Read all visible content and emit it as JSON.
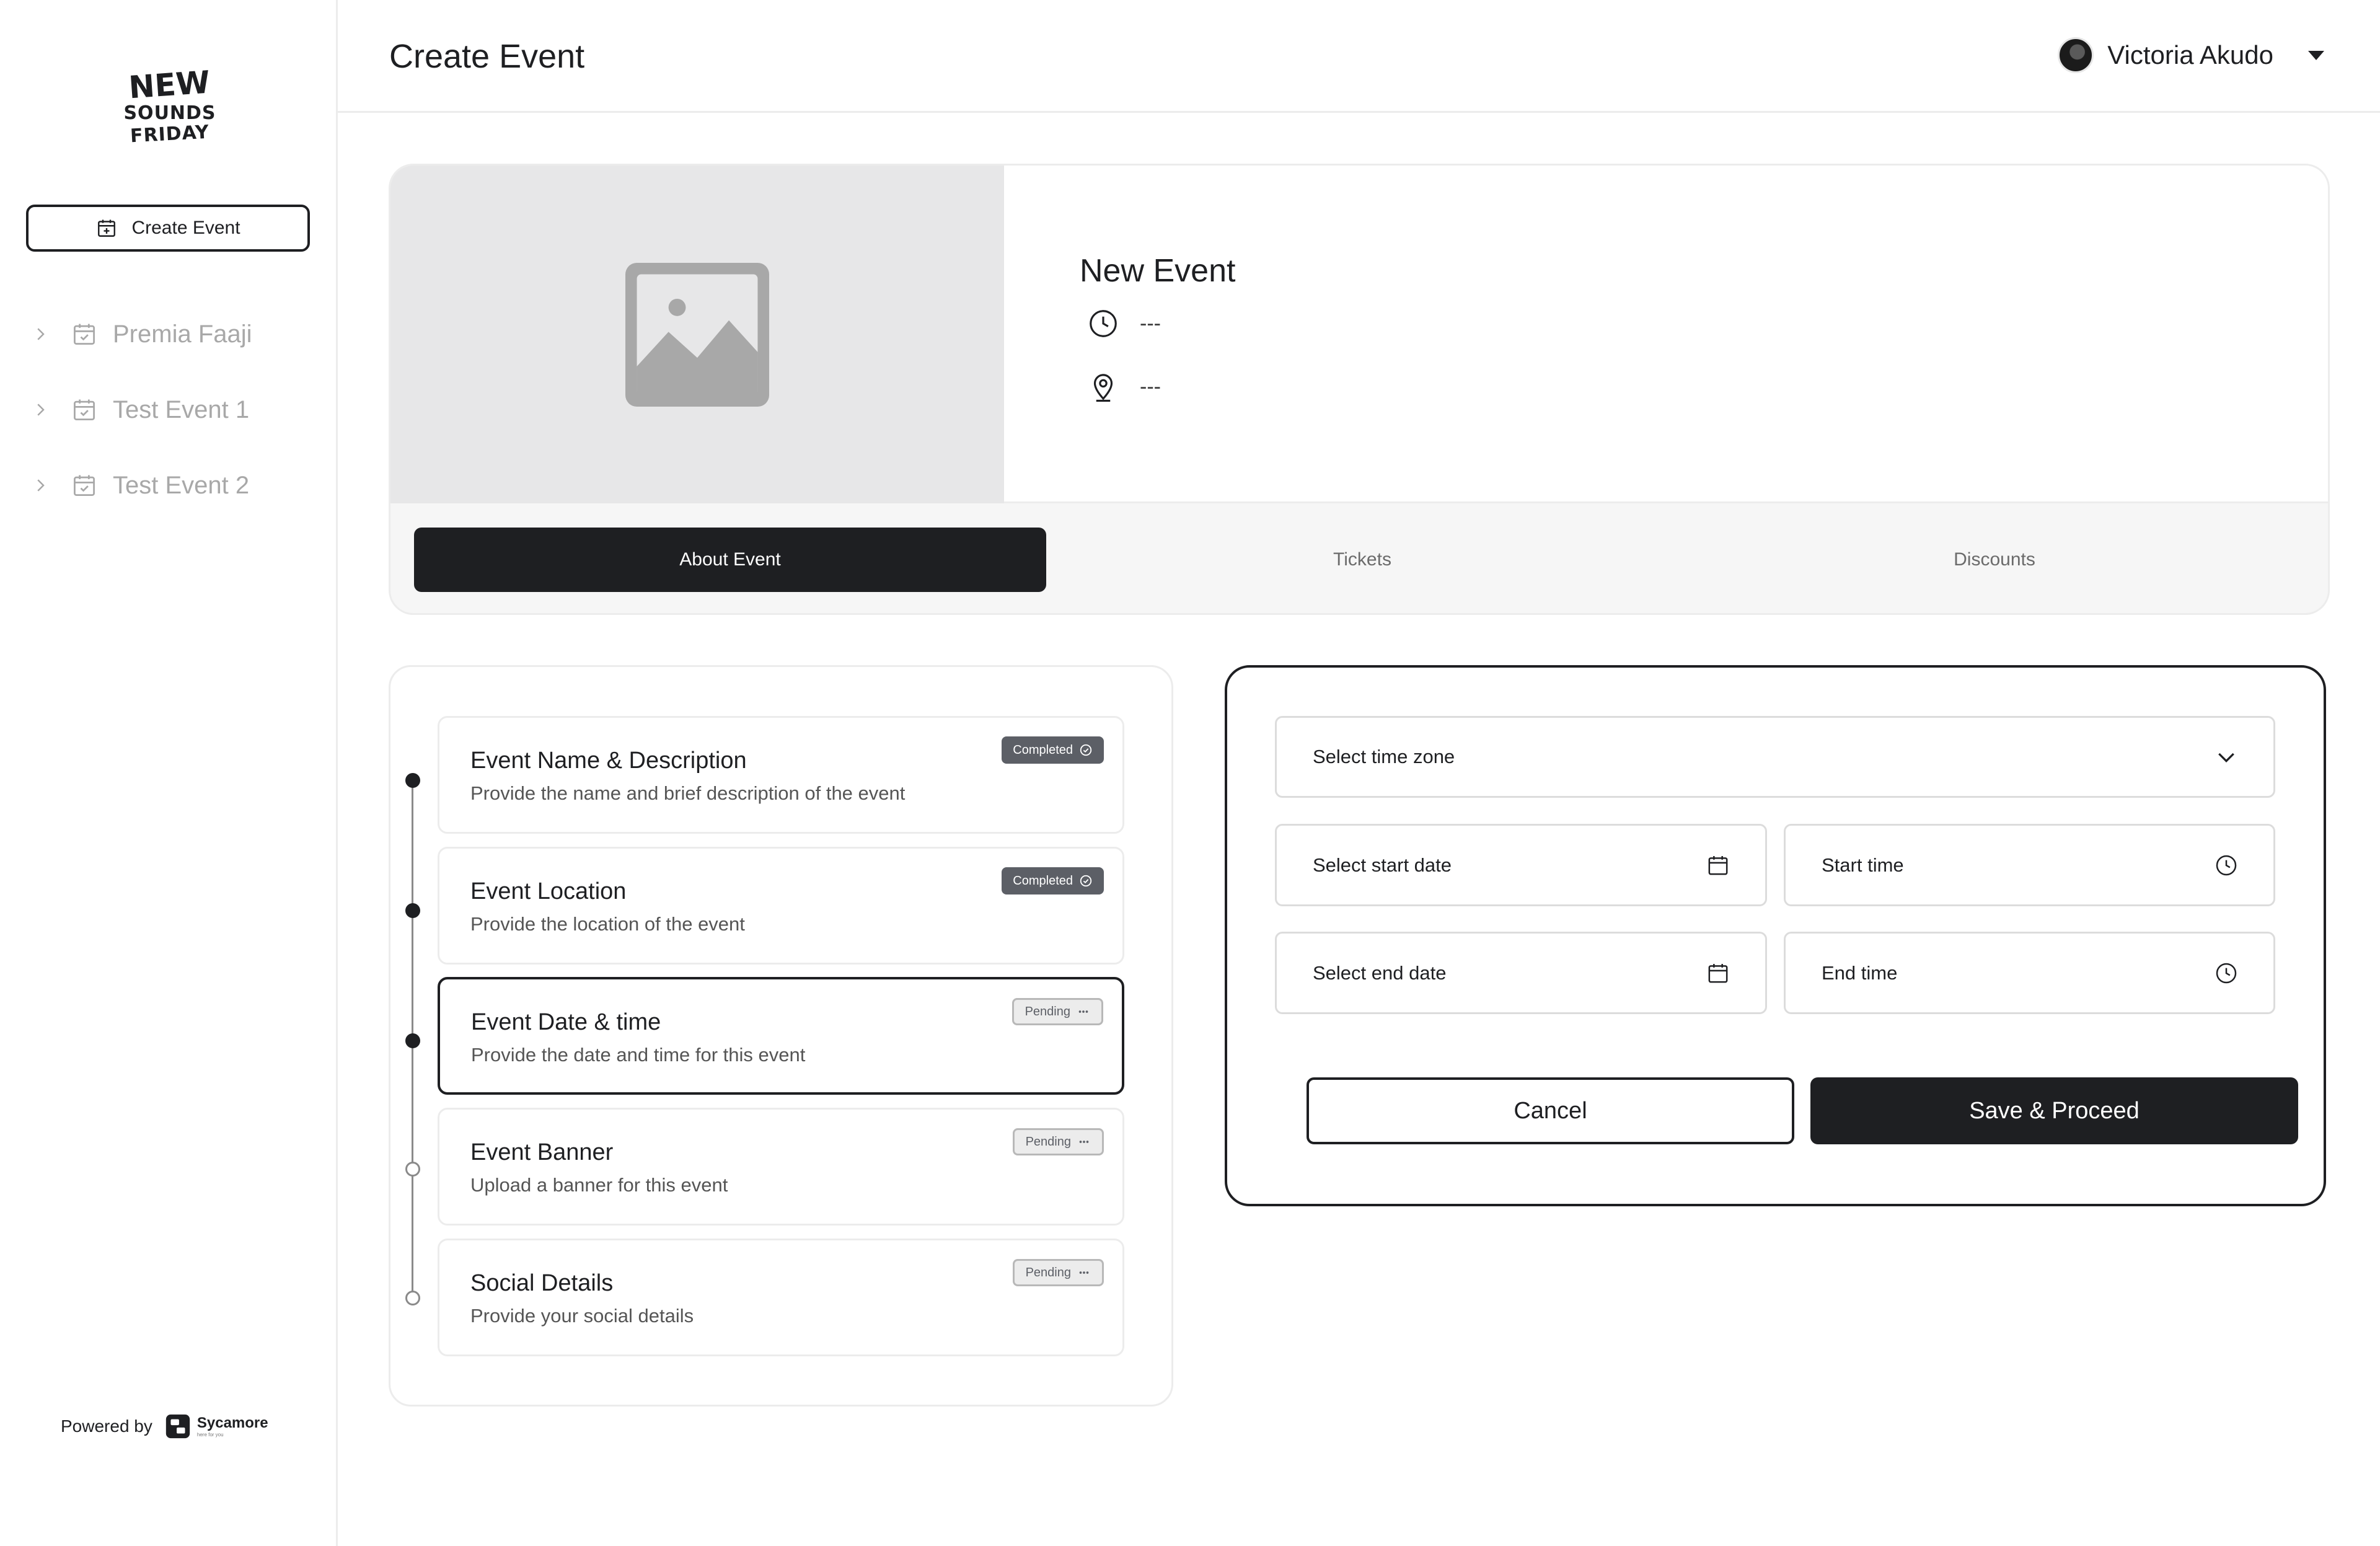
{
  "brand": {
    "logo_lines": [
      "NEW",
      "SOUNDS",
      "FRIDAY"
    ],
    "powered_by": "Powered by",
    "vendor_name": "Sycamore",
    "vendor_tagline": "here for you"
  },
  "sidebar": {
    "create_button": "Create Event",
    "items": [
      {
        "label": "Premia Faaji"
      },
      {
        "label": "Test Event 1"
      },
      {
        "label": "Test Event 2"
      }
    ]
  },
  "header": {
    "title": "Create Event",
    "user_name": "Victoria Akudo"
  },
  "event": {
    "name": "New Event",
    "time": "---",
    "location": "---"
  },
  "tabs": [
    {
      "label": "About Event",
      "active": true
    },
    {
      "label": "Tickets",
      "active": false
    },
    {
      "label": "Discounts",
      "active": false
    }
  ],
  "steps": [
    {
      "title": "Event Name & Description",
      "description": "Provide the name and brief description of the event",
      "status": "Completed"
    },
    {
      "title": "Event Location",
      "description": "Provide the location of the event",
      "status": "Completed"
    },
    {
      "title": "Event Date & time",
      "description": "Provide the date and time for this event",
      "status": "Pending"
    },
    {
      "title": "Event Banner",
      "description": "Upload a banner for this event",
      "status": "Pending"
    },
    {
      "title": "Social Details",
      "description": "Provide your social details",
      "status": "Pending"
    }
  ],
  "form": {
    "timezone_placeholder": "Select  time zone",
    "start_date_placeholder": "Select start date",
    "start_time_placeholder": "Start time",
    "end_date_placeholder": "Select end date",
    "end_time_placeholder": "End time",
    "cancel_label": "Cancel",
    "save_label": "Save & Proceed"
  },
  "colors": {
    "primary": "#1e1f22",
    "muted_text": "#a8a8a8",
    "border": "#ececec",
    "banner_bg": "#e7e7e8",
    "badge_completed": "#5c5f66"
  },
  "icons": {
    "create": "calendar-plus-icon",
    "event": "calendar-check-icon",
    "expand": "chevron-right-icon",
    "time": "clock-icon",
    "location": "map-pin-icon",
    "banner": "image-placeholder-icon",
    "dropdown": "chevron-down-icon",
    "date": "calendar-icon"
  }
}
